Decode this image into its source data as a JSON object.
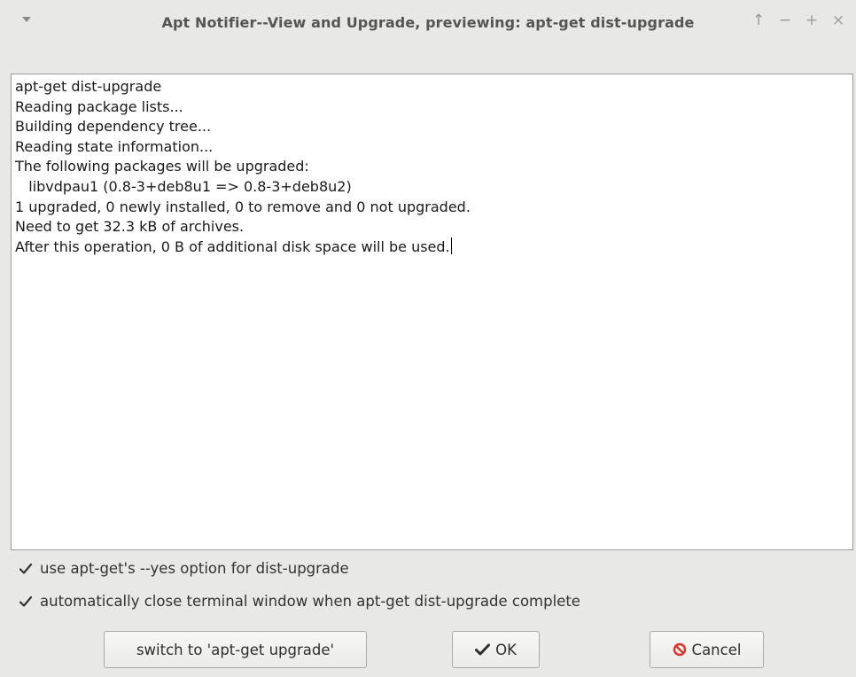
{
  "window": {
    "title": "Apt Notifier--View and Upgrade, previewing: apt-get dist-upgrade",
    "controls": [
      "↑",
      "−",
      "+",
      "×"
    ]
  },
  "output": {
    "lines": [
      "apt-get dist-upgrade",
      "Reading package lists...",
      "Building dependency tree...",
      "Reading state information...",
      "The following packages will be upgraded:",
      "   libvdpau1 (0.8-3+deb8u1 => 0.8-3+deb8u2)",
      "1 upgraded, 0 newly installed, 0 to remove and 0 not upgraded.",
      "Need to get 32.3 kB of archives.",
      "After this operation, 0 B of additional disk space will be used."
    ]
  },
  "options": {
    "yes_option": {
      "label": "use apt-get's --yes option for dist-upgrade",
      "checked": true
    },
    "auto_close": {
      "label": "automatically close terminal window when apt-get dist-upgrade complete",
      "checked": true
    }
  },
  "buttons": {
    "switch_label": "switch to 'apt-get upgrade'",
    "ok_label": "OK",
    "cancel_label": "Cancel"
  },
  "colors": {
    "window_bg": "#e8e8e7",
    "cancel_icon": "#d9352a"
  }
}
